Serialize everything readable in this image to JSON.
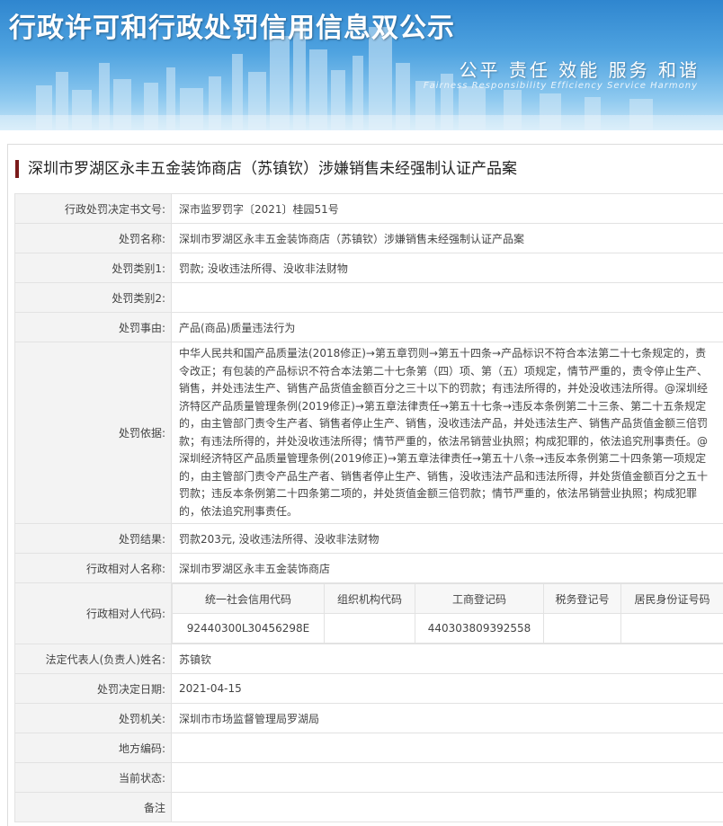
{
  "banner": {
    "title": "行政许可和行政处罚信用信息双公示",
    "slogan": "公平 责任 效能 服务 和谐",
    "slogan_en": "Fairness Responsibility Efficiency Service Harmony"
  },
  "case_title": "深圳市罗湖区永丰五金装饰商店（苏镇钦）涉嫌销售未经强制认证产品案",
  "rows": {
    "decision_no": {
      "label": "行政处罚决定书文号:",
      "value": "深市监罗罚字〔2021〕桂园51号"
    },
    "penalty_name": {
      "label": "处罚名称:",
      "value": "深圳市罗湖区永丰五金装饰商店（苏镇钦）涉嫌销售未经强制认证产品案"
    },
    "category1": {
      "label": "处罚类别1:",
      "value": "罚款; 没收违法所得、没收非法财物"
    },
    "category2": {
      "label": "处罚类别2:",
      "value": ""
    },
    "cause": {
      "label": "处罚事由:",
      "value": "产品(商品)质量违法行为"
    },
    "basis": {
      "label": "处罚依据:",
      "value": "中华人民共和国产品质量法(2018修正)→第五章罚则→第五十四条→产品标识不符合本法第二十七条规定的，责令改正；有包装的产品标识不符合本法第二十七条第（四）项、第（五）项规定，情节严重的，责令停止生产、销售，并处违法生产、销售产品货值金额百分之三十以下的罚款；有违法所得的，并处没收违法所得。@深圳经济特区产品质量管理条例(2019修正)→第五章法律责任→第五十七条→违反本条例第二十三条、第二十五条规定的，由主管部门责令生产者、销售者停止生产、销售，没收违法产品，并处违法生产、销售产品货值金额三倍罚款；有违法所得的，并处没收违法所得；情节严重的，依法吊销营业执照；构成犯罪的，依法追究刑事责任。@深圳经济特区产品质量管理条例(2019修正)→第五章法律责任→第五十八条→违反本条例第二十四条第一项规定的，由主管部门责令产品生产者、销售者停止生产、销售，没收违法产品和违法所得，并处货值金额百分之五十罚款；违反本条例第二十四条第二项的，并处货值金额三倍罚款；情节严重的，依法吊销营业执照；构成犯罪的，依法追究刑事责任。"
    },
    "result": {
      "label": "处罚结果:",
      "value": "罚款203元, 没收违法所得、没收非法财物"
    },
    "party_name": {
      "label": "行政相对人名称:",
      "value": "深圳市罗湖区永丰五金装饰商店"
    },
    "party_code": {
      "label": "行政相对人代码:"
    },
    "legal_rep": {
      "label": "法定代表人(负责人)姓名:",
      "value": "苏镇钦"
    },
    "date": {
      "label": "处罚决定日期:",
      "value": "2021-04-15"
    },
    "authority": {
      "label": "处罚机关:",
      "value": "深圳市市场监督管理局罗湖局"
    },
    "region_code": {
      "label": "地方编码:",
      "value": ""
    },
    "status": {
      "label": "当前状态:",
      "value": ""
    },
    "remark": {
      "label": "备注",
      "value": ""
    }
  },
  "codes": {
    "headers": {
      "uscc": "统一社会信用代码",
      "org": "组织机构代码",
      "biz": "工商登记码",
      "tax": "税务登记号",
      "id": "居民身份证号码"
    },
    "values": {
      "uscc": "92440300L30456298E",
      "org": "",
      "biz": "440303809392558",
      "tax": "",
      "id": ""
    }
  }
}
